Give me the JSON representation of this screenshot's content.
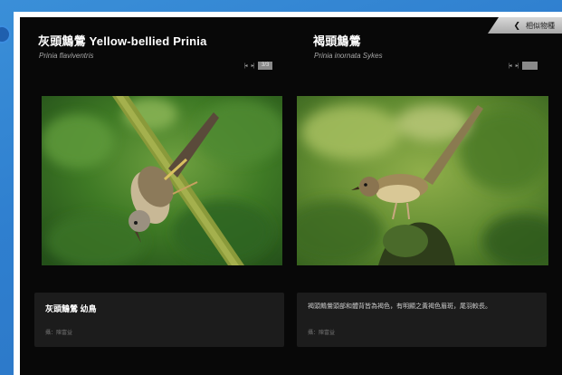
{
  "header": {
    "related_species_label": "相似物種",
    "back_icon": "chevron-left-icon"
  },
  "cards": [
    {
      "common_name": "灰頭鷦鶯 Yellow-bellied Prinia",
      "scientific_name": "Prinia flaviventris",
      "pager": {
        "prev": "|◂",
        "next": "▸|",
        "count": "3/3"
      },
      "caption_title": "灰頭鷦鶯 幼鳥",
      "caption_credit": "攝：陳富益"
    },
    {
      "common_name": "褐頭鷦鶯",
      "scientific_name": "Prinia inornata Sykes",
      "pager": {
        "prev": "|◂",
        "next": "▸|",
        "count": ""
      },
      "caption_desc": "褐頭鷦鶯頭部和體背皆為褐色，有明顯之黃褐色眉斑，尾羽較長。",
      "caption_credit": "攝：陳富益"
    }
  ],
  "colors": {
    "background_blue": "#2f7fcf",
    "panel_black": "#080808",
    "caption_bg": "#1c1c1c",
    "tab_grey": "#bdbdbd"
  }
}
